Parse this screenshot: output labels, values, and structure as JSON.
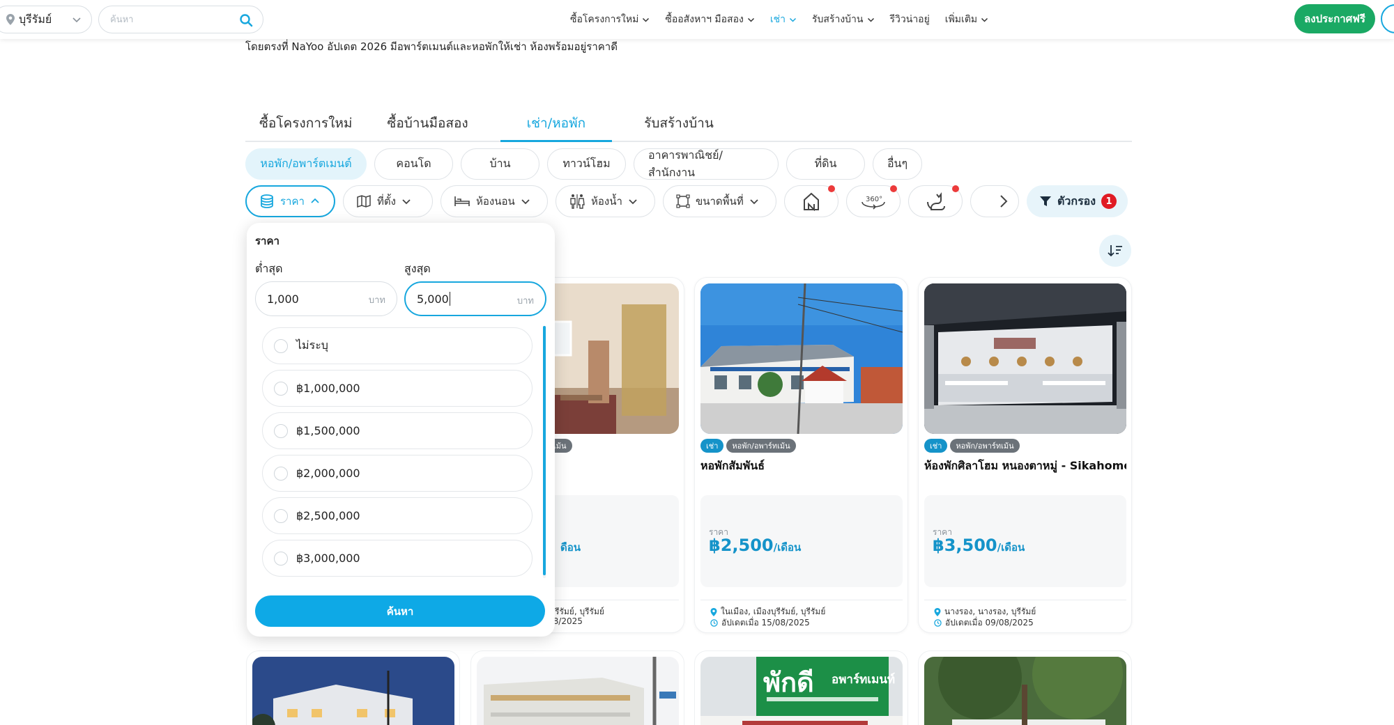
{
  "header": {
    "location": "บุรีรัมย์",
    "search_placeholder": "ค้นหา",
    "nav": [
      {
        "label": "ซื้อโครงการใหม่",
        "active": false
      },
      {
        "label": "ซื้ออสังหาฯ มือสอง",
        "active": false
      },
      {
        "label": "เช่า",
        "active": true
      },
      {
        "label": "รับสร้างบ้าน",
        "active": false
      },
      {
        "label": "รีวิวน่าอยู่",
        "active": false
      },
      {
        "label": "เพิ่มเติม",
        "active": false
      }
    ],
    "post_label": "ลงประกาศฟรี",
    "accent": "#17a7de",
    "post_color": "#1aa964"
  },
  "intro": {
    "line2": "โดยตรงที่ NaYoo อัปเดต 2026 มีอพาร์ตเมนต์และหอพักให้เช่า ห้องพร้อมอยู่ราคาดี"
  },
  "category_tabs": [
    "ซื้อโครงการใหม่",
    "ซื้อบ้านมือสอง",
    "เช่า/หอพัก",
    "รับสร้างบ้าน"
  ],
  "active_tab": "เช่า/หอพัก",
  "type_chips": [
    "หอพัก/อพาร์ตเมนต์",
    "คอนโด",
    "บ้าน",
    "ทาวน์โฮม",
    "อาคารพาณิชย์/สำนักงาน",
    "ที่ดิน",
    "อื่นๆ"
  ],
  "filters": {
    "price": "ราคา",
    "location": "ที่ตั้ง",
    "bedroom": "ห้องนอน",
    "bathroom": "ห้องน้ำ",
    "area": "ขนาดพื้นที่",
    "all_filters": "ตัวกรอง",
    "filter_count": "1"
  },
  "price_popover": {
    "title": "ราคา",
    "min_label": "ต่ำสุด",
    "max_label": "สูงสุด",
    "min_value": "1,000",
    "max_value": "5,000",
    "unit": "บาท",
    "options": [
      "ไม่ระบุ",
      "฿1,000,000",
      "฿1,500,000",
      "฿2,000,000",
      "฿2,500,000",
      "฿3,000,000"
    ],
    "submit": "ค้นหา"
  },
  "listings": [
    {
      "tag_rent": "เช่า",
      "tag_type": "หอพัก/อพาร์ทเม้น",
      "title": "หอพักสัมพันธ์",
      "price_label": "ราคา",
      "price": "฿2,500",
      "per": "/เดือน",
      "location": "ในเมือง, เมืองบุรีรัมย์, บุรีรัมย์",
      "updated": "อัปเดตเมื่อ 15/08/2025"
    },
    {
      "tag_rent": "เช่า",
      "tag_type": "หอพัก/อพาร์ทเม้น",
      "title": "ห้องพักศิลาโฮม หนองตาหมู่ - Sikahome",
      "price_label": "ราคา",
      "price": "฿3,500",
      "per": "/เดือน",
      "location": "นางรอง, นางรอง, บุรีรัมย์",
      "updated": "อัปเดตเมื่อ 09/08/2025"
    }
  ],
  "partial_card": {
    "tag_type_fragment": "เม้น",
    "price_fragment": "ดือน",
    "location_fragment": "รีรัมย์, บุรีรัมย์",
    "updated_fragment": "08/2025"
  },
  "bottom_sign": {
    "big": "พักดี",
    "small": "อพาร์ทเมนท์"
  }
}
